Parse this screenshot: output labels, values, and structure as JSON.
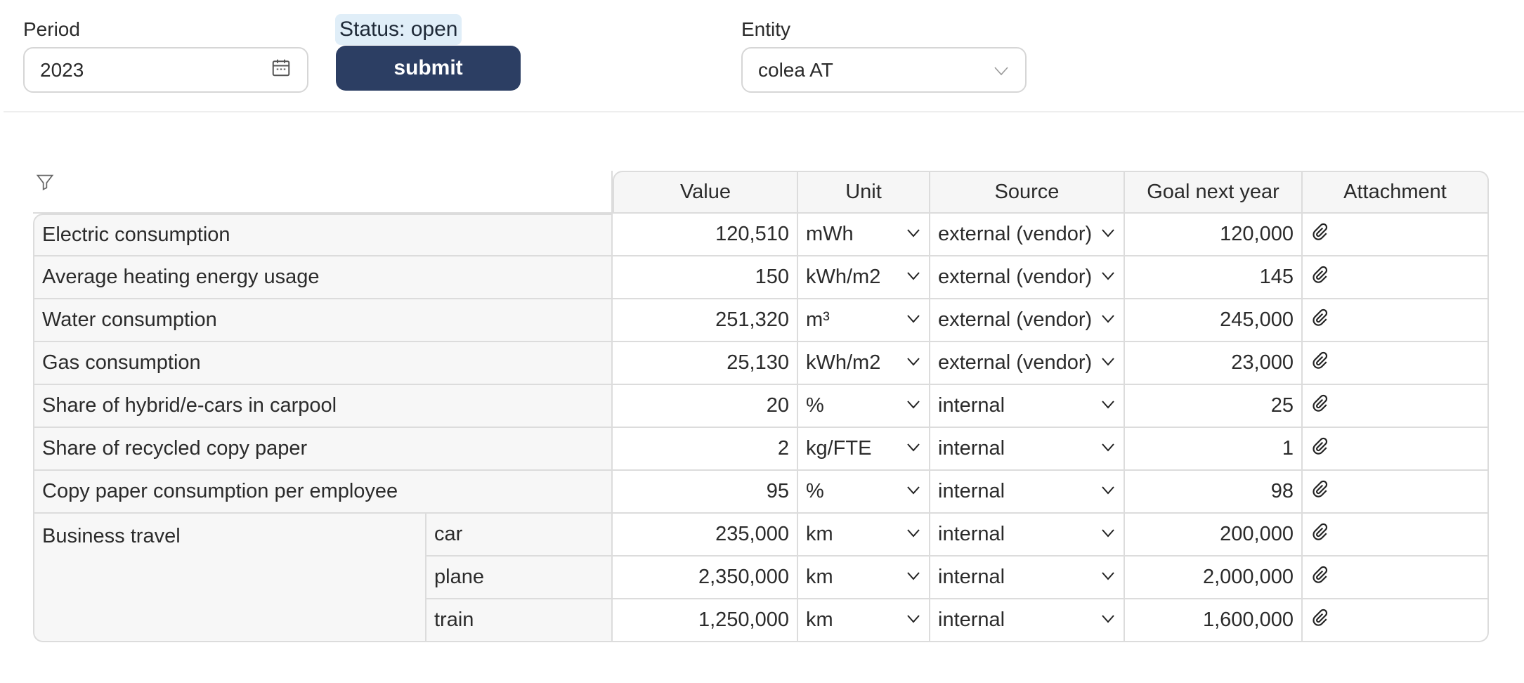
{
  "period": {
    "label": "Period",
    "value": "2023",
    "icon": "calendar-icon"
  },
  "status": {
    "text": "Status: open"
  },
  "submit": {
    "label": "submit"
  },
  "entity": {
    "label": "Entity",
    "value": "colea AT",
    "icon": "chevron-down-icon"
  },
  "colors": {
    "submit_bg": "#2c3e63",
    "status_bg": "#e0eef8",
    "border": "#dcdcdc",
    "label_bg": "#f7f7f7"
  },
  "table": {
    "filter_icon": "filter-icon",
    "headers": {
      "value": "Value",
      "unit": "Unit",
      "source": "Source",
      "goal": "Goal next year",
      "attachment": "Attachment"
    },
    "rows": [
      {
        "name": "Electric consumption",
        "value": "120,510",
        "unit": "mWh",
        "source": "external (vendor)",
        "goal": "120,000"
      },
      {
        "name": "Average heating energy usage",
        "value": "150",
        "unit": "kWh/m2",
        "source": "external (vendor)",
        "goal": "145"
      },
      {
        "name": "Water consumption",
        "value": "251,320",
        "unit": "m³",
        "source": "external (vendor)",
        "goal": "245,000"
      },
      {
        "name": "Gas consumption",
        "value": "25,130",
        "unit": "kWh/m2",
        "source": "external (vendor)",
        "goal": "23,000"
      },
      {
        "name": "Share of hybrid/e-cars in carpool",
        "value": "20",
        "unit": "%",
        "source": "internal",
        "goal": "25"
      },
      {
        "name": "Share of recycled copy paper",
        "value": "2",
        "unit": "kg/FTE",
        "source": "internal",
        "goal": "1"
      },
      {
        "name": "Copy paper consumption per employee",
        "value": "95",
        "unit": "%",
        "source": "internal",
        "goal": "98"
      }
    ],
    "group": {
      "name": "Business travel",
      "rows": [
        {
          "sub": "car",
          "value": "235,000",
          "unit": "km",
          "source": "internal",
          "goal": "200,000"
        },
        {
          "sub": "plane",
          "value": "2,350,000",
          "unit": "km",
          "source": "internal",
          "goal": "2,000,000"
        },
        {
          "sub": "train",
          "value": "1,250,000",
          "unit": "km",
          "source": "internal",
          "goal": "1,600,000"
        }
      ]
    }
  }
}
